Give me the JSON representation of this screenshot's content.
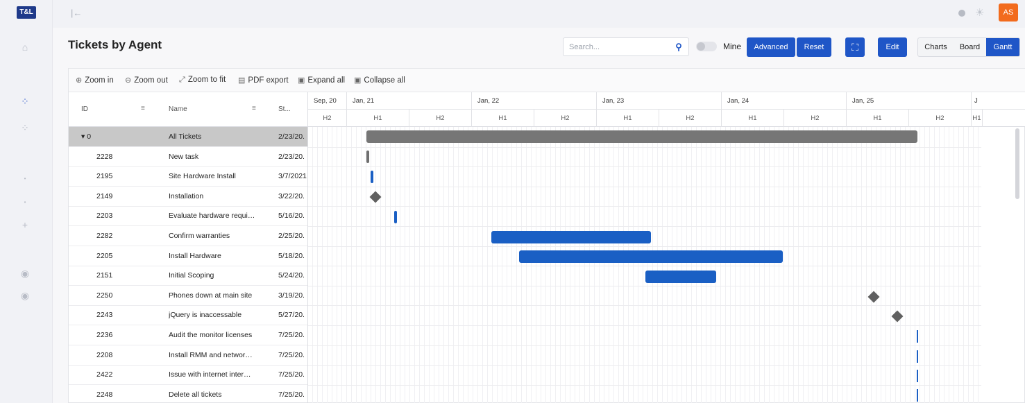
{
  "app": {
    "logo_text": "T&L"
  },
  "topbar": {
    "avatar_initials": "AS"
  },
  "page": {
    "title": "Tickets by Agent"
  },
  "controls": {
    "search_placeholder": "Search...",
    "mine_label": "Mine",
    "advanced_label": "Advanced",
    "reset_label": "Reset",
    "edit_label": "Edit",
    "view_tabs": [
      "Charts",
      "Board",
      "Gantt"
    ],
    "active_view": "Gantt"
  },
  "gantt_toolbar": {
    "zoom_in": "Zoom in",
    "zoom_out": "Zoom out",
    "zoom_to_fit": "Zoom to fit",
    "pdf_export": "PDF export",
    "expand_all": "Expand all",
    "collapse_all": "Collapse all"
  },
  "grid": {
    "columns": {
      "id": "ID",
      "name": "Name",
      "start": "St..."
    },
    "rows": [
      {
        "id": "0",
        "name": "All Tickets",
        "start": "2/23/20.",
        "parent": true
      },
      {
        "id": "2228",
        "name": "New task",
        "start": "2/23/20."
      },
      {
        "id": "2195",
        "name": "Site Hardware Install",
        "start": "3/7/2021"
      },
      {
        "id": "2149",
        "name": "Installation",
        "start": "3/22/20."
      },
      {
        "id": "2203",
        "name": "Evaluate hardware requir...",
        "start": "5/16/20."
      },
      {
        "id": "2282",
        "name": "Confirm warranties",
        "start": "2/25/20."
      },
      {
        "id": "2205",
        "name": "Install Hardware",
        "start": "5/18/20."
      },
      {
        "id": "2151",
        "name": "Initial Scoping",
        "start": "5/24/20."
      },
      {
        "id": "2250",
        "name": "Phones down at main site",
        "start": "3/19/20."
      },
      {
        "id": "2243",
        "name": "jQuery is inaccessable",
        "start": "5/27/20."
      },
      {
        "id": "2236",
        "name": "Audit the monitor licenses",
        "start": "7/25/20."
      },
      {
        "id": "2208",
        "name": "Install RMM and network ...",
        "start": "7/25/20."
      },
      {
        "id": "2422",
        "name": "Issue with internet interm...",
        "start": "7/25/20."
      },
      {
        "id": "2248",
        "name": "Delete all tickets",
        "start": "7/25/20."
      }
    ]
  },
  "timeline": {
    "years": [
      "Sep, 20",
      "Jan, 21",
      "Jan, 22",
      "Jan, 23",
      "Jan, 24",
      "Jan, 25",
      "J"
    ],
    "halves": [
      "H2",
      "H1",
      "H2",
      "H1",
      "H2",
      "H1",
      "H2",
      "H1",
      "H2",
      "H1",
      "H2",
      "H1"
    ]
  },
  "colors": {
    "accent": "#1f56c7",
    "avatar": "#f26b1d",
    "bar": "#1a5fc4",
    "parent_bar": "#767676"
  }
}
